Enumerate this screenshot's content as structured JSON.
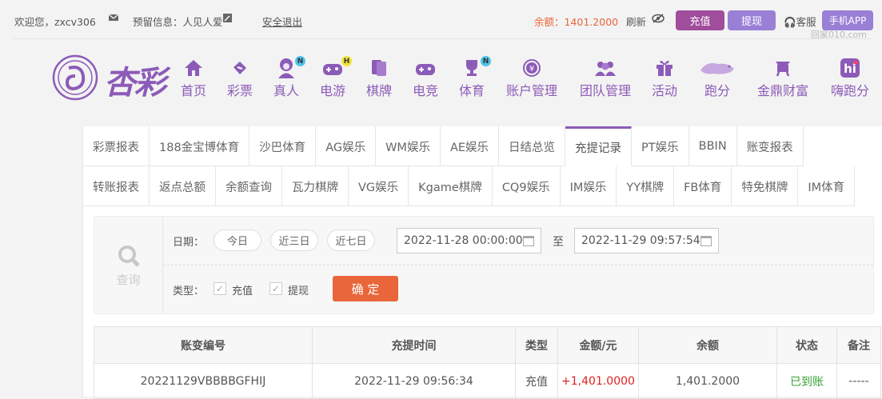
{
  "topbar": {
    "welcome": "欢迎您，zxcv306",
    "reserved": "预留信息：人见人爱",
    "logout": "安全退出",
    "balance": "余额：1401.2000",
    "refresh": "刷新",
    "recharge": "充值",
    "withdraw": "提现",
    "service": "客服",
    "app": "手机APP",
    "watermark": "回家010.com"
  },
  "logo": {
    "text": "杏彩"
  },
  "nav": [
    {
      "label": "首页"
    },
    {
      "label": "彩票"
    },
    {
      "label": "真人",
      "badge": "N"
    },
    {
      "label": "电游",
      "badge": "H"
    },
    {
      "label": "棋牌"
    },
    {
      "label": "电竞"
    },
    {
      "label": "体育",
      "badge": "N"
    },
    {
      "label": "账户管理"
    },
    {
      "label": "团队管理"
    },
    {
      "label": "活动"
    },
    {
      "label": "跑分"
    },
    {
      "label": "金鼎财富"
    },
    {
      "label": "嗨跑分"
    }
  ],
  "tabs_row1": [
    "彩票报表",
    "188金宝博体育",
    "沙巴体育",
    "AG娱乐",
    "WM娱乐",
    "AE娱乐",
    "日结总览",
    "充提记录",
    "PT娱乐",
    "BBIN",
    "账变报表"
  ],
  "tabs_row2": [
    "转账报表",
    "返点总额",
    "余额查询",
    "瓦力棋牌",
    "VG娱乐",
    "Kgame棋牌",
    "CQ9娱乐",
    "IM娱乐",
    "YY棋牌",
    "FB体育",
    "特免棋牌",
    "IM体育"
  ],
  "query": {
    "label": "查询",
    "date_label": "日期：",
    "today": "今日",
    "three_days": "近三日",
    "seven_days": "近七日",
    "start": "2022-11-28 00:00:00",
    "to": "至",
    "end": "2022-11-29 09:57:54",
    "type_label": "类型：",
    "type_recharge": "充值",
    "type_withdraw": "提现",
    "confirm": "确 定"
  },
  "table": {
    "headers": [
      "账变编号",
      "充提时间",
      "类型",
      "金额/元",
      "余额",
      "状态",
      "备注"
    ],
    "rows": [
      [
        "20221129VBBBBGFHIJ",
        "2022-11-29 09:56:34",
        "充值",
        "+1,401.0000",
        "1,401.2000",
        "已到账",
        "-----"
      ]
    ]
  },
  "colors": {
    "accent": "#8c5bb8",
    "orange": "#e8663a",
    "success": "#3aa03a",
    "amount": "#e02020"
  }
}
